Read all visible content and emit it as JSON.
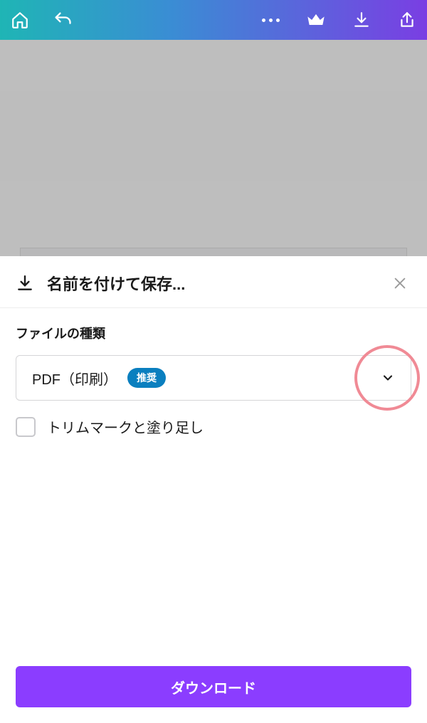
{
  "sheet": {
    "title": "名前を付けて保存...",
    "section_label": "ファイルの種類",
    "select": {
      "value": "PDF（印刷）",
      "badge": "推奨"
    },
    "checkbox_label": "トリムマークと塗り足し",
    "download_button": "ダウンロード"
  },
  "icons": {
    "home": "home-icon",
    "undo": "undo-icon",
    "more": "more-icon",
    "crown": "crown-icon",
    "download": "download-icon",
    "share": "share-icon",
    "close": "close-icon",
    "chevron": "chevron-down-icon"
  }
}
